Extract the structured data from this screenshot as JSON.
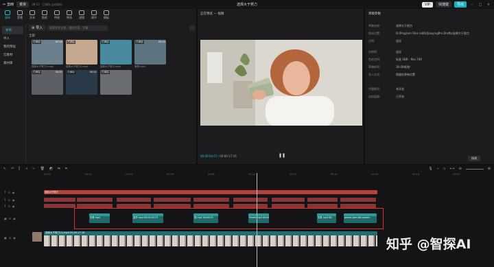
{
  "titlebar": {
    "app_name": "剪映",
    "menu_label": "菜单",
    "autosave": "09:37 · 已保存 自动保存",
    "project_title": "选择大于努力",
    "vip_label": "VIP",
    "shortcut_label": "快捷键",
    "export_label": "导出"
  },
  "tools": [
    {
      "label": "媒体",
      "active": true
    },
    {
      "label": "音频"
    },
    {
      "label": "文本"
    },
    {
      "label": "贴纸"
    },
    {
      "label": "特效"
    },
    {
      "label": "转场"
    },
    {
      "label": "滤镜"
    },
    {
      "label": "调节"
    },
    {
      "label": "模板"
    }
  ],
  "sidenav": [
    "本地",
    "导入",
    "我的预设",
    "云素材",
    "素材库"
  ],
  "media": {
    "import_label": "导入",
    "search_placeholder": "搜索文件名称、视频文案、字幕",
    "folder_label": "全部",
    "thumbs": [
      {
        "tag": "已添加",
        "dur": "00:40",
        "name": "选择大于努力1.mp4",
        "color": "#6b7f8c"
      },
      {
        "tag": "已添加",
        "dur": "",
        "name": "选择大于努力2.mp4",
        "color": "#c5a98e"
      },
      {
        "tag": "已添加",
        "dur": "",
        "name": "选择大于努力.mp4",
        "color": "#4a8aa1"
      },
      {
        "tag": "已添加",
        "dur": "00:43",
        "name": "海浪.mp4",
        "color": "#5c7480"
      },
      {
        "tag": "已添加",
        "dur": "00:01",
        "name": "",
        "color": "#5d5f66"
      },
      {
        "tag": "已添加",
        "dur": "00:01",
        "name": "",
        "color": "#2b3a48"
      },
      {
        "tag": "已添加",
        "dur": "",
        "name": "",
        "color": "#6a6d71"
      }
    ]
  },
  "player": {
    "title": "正在预览 — 视频",
    "current_time": "00:00:04:07",
    "total_time": "00:00:17:16"
  },
  "details": {
    "title": "草稿参数",
    "rows": [
      {
        "label": "草稿名称:",
        "value": "选择大于努力"
      },
      {
        "label": "保存位置:",
        "value": "D:/Program Files (x86)/JianyingPro Drafts/选择大于努力"
      },
      {
        "label": "比例:",
        "value": "适应"
      },
      {
        "label": "分辨率:",
        "value": "适应"
      },
      {
        "label": "色彩空间:",
        "value": "标准 SDR - Rec.709"
      },
      {
        "label": "草稿帧率:",
        "value": "30.00帧/秒"
      },
      {
        "label": "导入方式:",
        "value": "保留在原有位置"
      },
      {
        "label": "代理模式:",
        "value": "未开启"
      },
      {
        "label": "自由层级:",
        "value": "已开启"
      }
    ],
    "modify_label": "修改"
  },
  "timeline": {
    "ruler": [
      "00:00",
      "00:02",
      "00:04",
      "00:06",
      "00:08",
      "00:10",
      "00:12",
      "00:14",
      "00:16",
      "00:18",
      "00:20"
    ],
    "text_track_label": "选择大于努力",
    "main_clip_label": "选择大于努力(1).mp4  00:00:17:16",
    "video_clips": [
      {
        "label": "手势.mp4"
      },
      {
        "label": "金币.mp4  00:00:03:23"
      },
      {
        "label": "钱.mp4  00:00:03"
      },
      {
        "label": "Pexels.mp4  00:00"
      },
      {
        "label": "手机.mp4  00:"
      },
      {
        "label": "pexels-tom-fisk-pexels"
      }
    ]
  },
  "watermark": "知乎 @智探AI"
}
